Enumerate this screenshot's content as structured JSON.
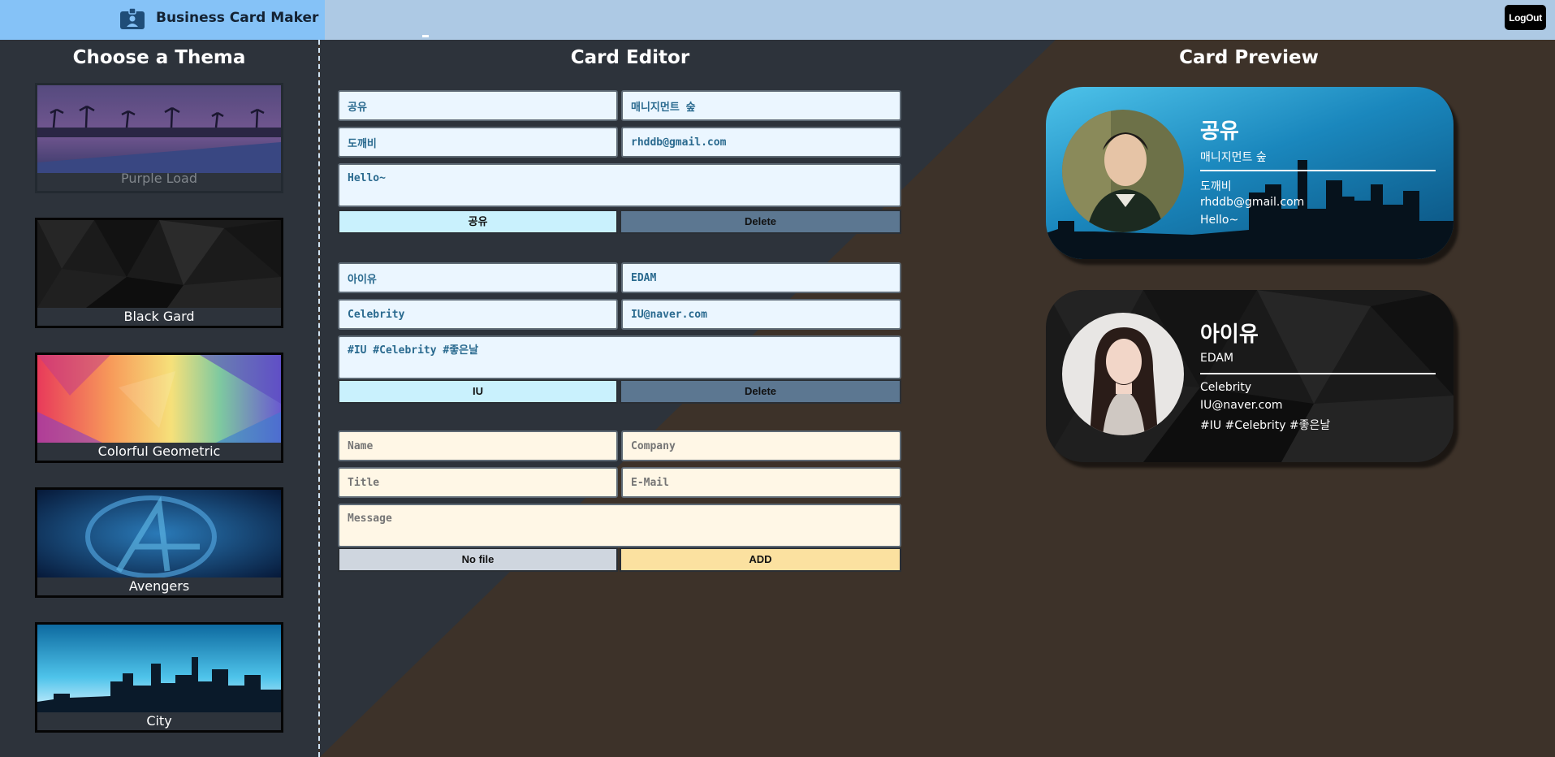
{
  "header": {
    "title": "Business Card Maker",
    "logout_label": "LogOut"
  },
  "themes_panel": {
    "title": "Choose a Thema",
    "themes": [
      {
        "label": "Purple Load"
      },
      {
        "label": "Black Gard"
      },
      {
        "label": "Colorful Geometric"
      },
      {
        "label": "Avengers"
      },
      {
        "label": "City"
      }
    ]
  },
  "editor": {
    "title": "Card Editor",
    "cards": [
      {
        "name": "공유",
        "company": "매니지먼트 숲",
        "title": "도깨비",
        "email": "rhddb@gmail.com",
        "message": "Hello~",
        "file_label": "공유",
        "delete_label": "Delete"
      },
      {
        "name": "아이유",
        "company": "EDAM",
        "title": "Celebrity",
        "email": "IU@naver.com",
        "message": "#IU #Celebrity #좋은날",
        "file_label": "IU",
        "delete_label": "Delete"
      }
    ],
    "new_card": {
      "name_placeholder": "Name",
      "company_placeholder": "Company",
      "title_placeholder": "Title",
      "email_placeholder": "E-Mail",
      "message_placeholder": "Message",
      "file_label": "No file",
      "add_label": "ADD"
    }
  },
  "preview": {
    "title": "Card Preview",
    "cards": [
      {
        "name": "공유",
        "company": "매니지먼트 숲",
        "title": "도깨비",
        "email": "rhddb@gmail.com",
        "message": "Hello~",
        "theme": "City"
      },
      {
        "name": "아이유",
        "company": "EDAM",
        "title": "Celebrity",
        "email": "IU@naver.com",
        "message": "#IU #Celebrity #좋은날",
        "theme": "Black Gard"
      }
    ]
  },
  "colors": {
    "header": "#adc9e4",
    "header_left": "#85c2f7",
    "panel": "#2d333b",
    "right_bg": "#3d3229",
    "file_button": "#c9f1fd",
    "delete_button": "#5c7791",
    "add_button": "#fbe1a0"
  },
  "icons": {
    "logo": "id-badge-icon"
  }
}
